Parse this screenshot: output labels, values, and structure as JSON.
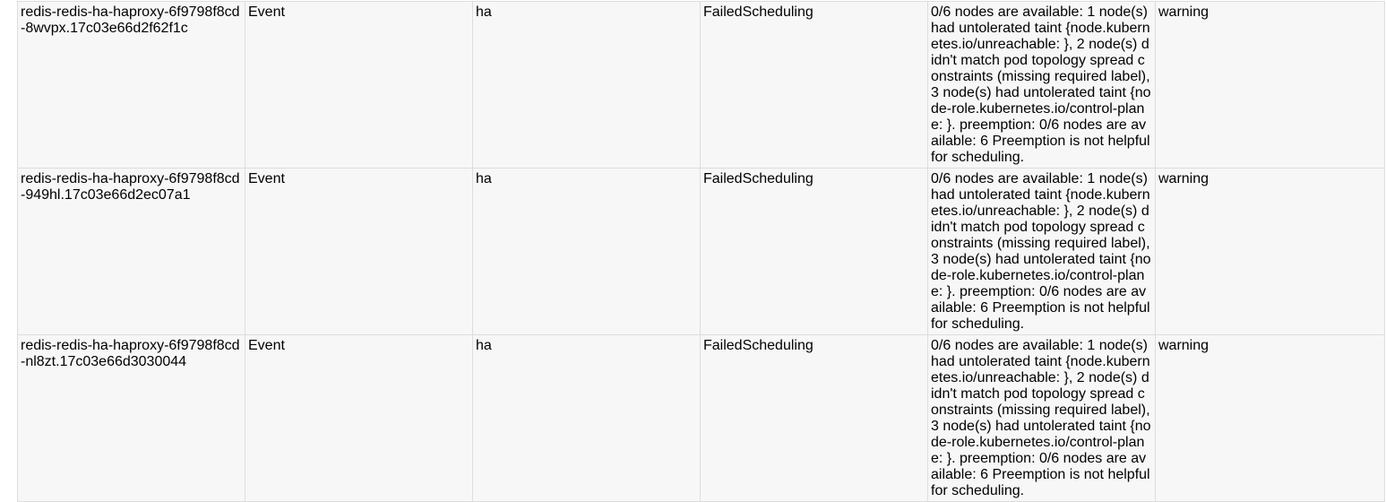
{
  "events": [
    {
      "name": "redis-redis-ha-haproxy-6f9798f8cd-8wvpx.17c03e66d2f62f1c",
      "kind": "Event",
      "namespace": "ha",
      "reason": "FailedScheduling",
      "message": "0/6 nodes are available: 1 node(s) had untolerated taint {node.kubernetes.io/unreachable: }, 2 node(s) didn't match pod topology spread constraints (missing required label), 3 node(s) had untolerated taint {node-role.kubernetes.io/control-plane: }. preemption: 0/6 nodes are available: 6 Preemption is not helpful for scheduling.",
      "type": "warning"
    },
    {
      "name": "redis-redis-ha-haproxy-6f9798f8cd-949hl.17c03e66d2ec07a1",
      "kind": "Event",
      "namespace": "ha",
      "reason": "FailedScheduling",
      "message": "0/6 nodes are available: 1 node(s) had untolerated taint {node.kubernetes.io/unreachable: }, 2 node(s) didn't match pod topology spread constraints (missing required label), 3 node(s) had untolerated taint {node-role.kubernetes.io/control-plane: }. preemption: 0/6 nodes are available: 6 Preemption is not helpful for scheduling.",
      "type": "warning"
    },
    {
      "name": "redis-redis-ha-haproxy-6f9798f8cd-nl8zt.17c03e66d3030044",
      "kind": "Event",
      "namespace": "ha",
      "reason": "FailedScheduling",
      "message": "0/6 nodes are available: 1 node(s) had untolerated taint {node.kubernetes.io/unreachable: }, 2 node(s) didn't match pod topology spread constraints (missing required label), 3 node(s) had untolerated taint {node-role.kubernetes.io/control-plane: }. preemption: 0/6 nodes are available: 6 Preemption is not helpful for scheduling.",
      "type": "warning"
    }
  ]
}
